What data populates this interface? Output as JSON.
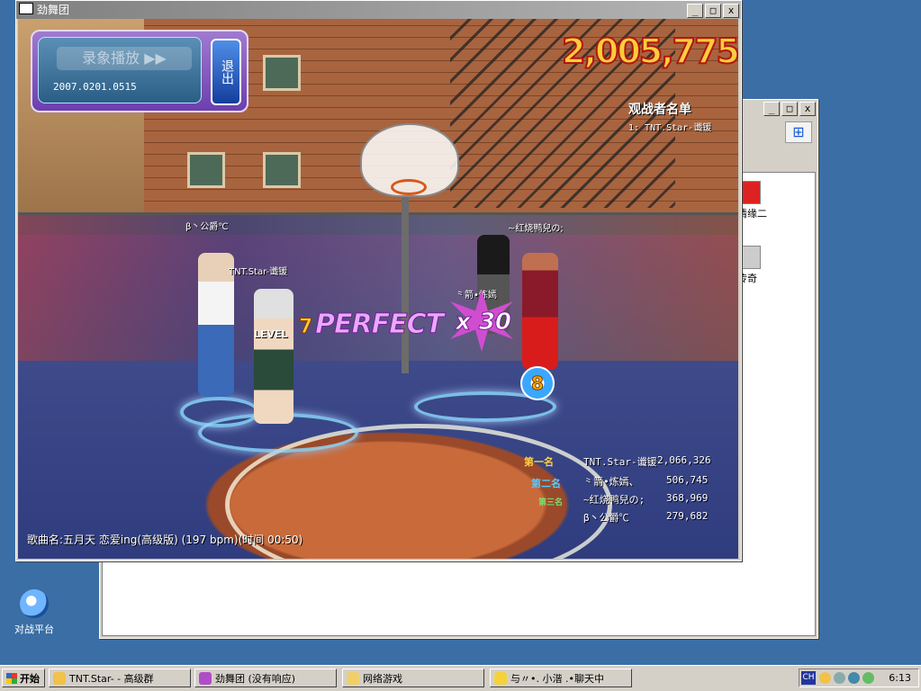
{
  "desktop": {
    "icon_label": "对战平台"
  },
  "background_window": {
    "item1_label": "情缘二",
    "item2_label": "传奇"
  },
  "game_window": {
    "title": "劲舞团",
    "replay": {
      "label": "录象播放 ▶▶",
      "date": "2007.0201.0515",
      "exit_label": "退出"
    },
    "score": "2,005,775",
    "spectators": {
      "title": "观战者名单",
      "items": [
        "1: TNT.Star-谶锾"
      ]
    },
    "players": [
      "β丶公爵℃",
      "TNT.Star-谶锾",
      "⺀箭•炼嫣",
      "~红烧鸭兒の;"
    ],
    "judgement": {
      "combo_prefix": "7",
      "word": "PERFECT",
      "multiplier": "x 30",
      "level_label": "LEVEL",
      "bubble": "8"
    },
    "rankings": {
      "badges": [
        "第一名",
        "第二名",
        "第三名"
      ],
      "rows": [
        {
          "name": "TNT.Star-谶锾",
          "score": "2,066,326"
        },
        {
          "name": "⺀箭•炼嫣、",
          "score": "506,745"
        },
        {
          "name": "~红烧鸭兒の;",
          "score": "368,969"
        },
        {
          "name": "β丶公爵℃",
          "score": "279,682"
        }
      ]
    },
    "song_info": "歌曲名:五月天 恋爱ing(高级版) (197 bpm)(时间 00:50)"
  },
  "taskbar": {
    "start_label": "开始",
    "tasks": [
      "TNT.Star- - 高级群",
      "劲舞团 (没有响应)",
      "网络游戏",
      "与〃•. 小湝 .•聊天中"
    ],
    "ime": "CH",
    "clock": "6:13"
  },
  "colors": {
    "desktop": "#3a6ea5",
    "score_fill": "#ffcd3c",
    "score_stroke": "#b0170e",
    "perfect": "#e9a8ff"
  }
}
